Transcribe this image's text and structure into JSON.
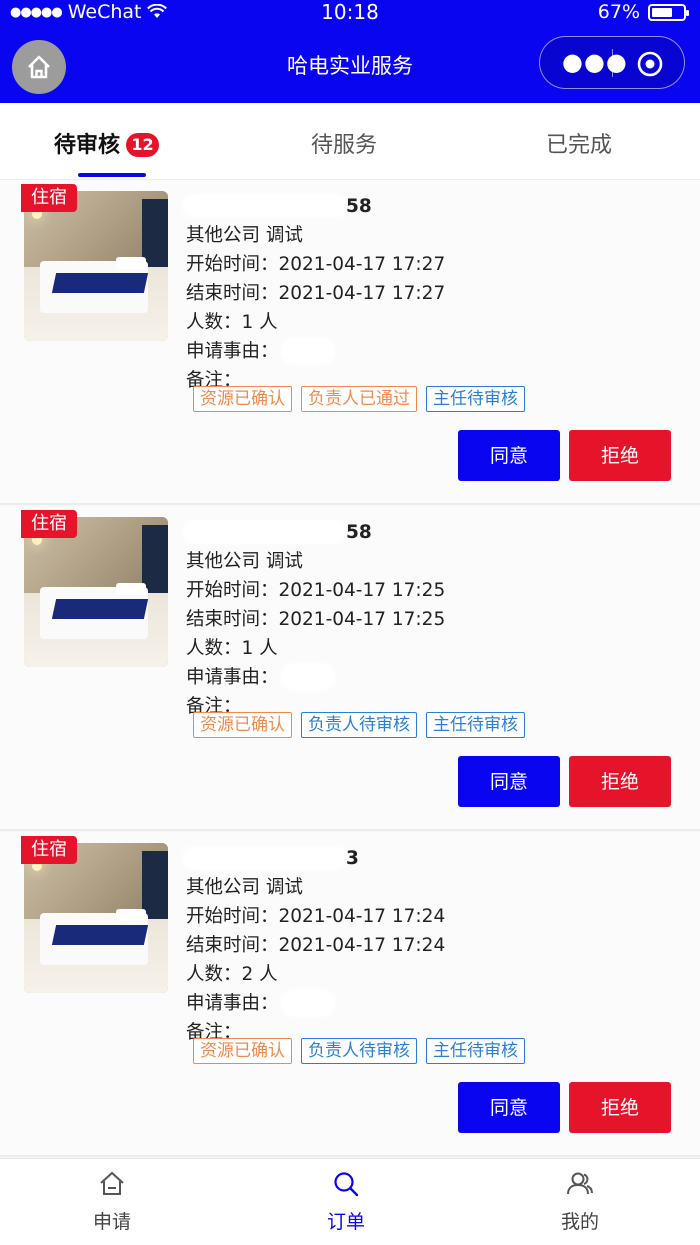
{
  "status_bar": {
    "signal": "●●●●●",
    "carrier": "WeChat",
    "time": "10:18",
    "battery": "67%",
    "battery_level": 0.67
  },
  "nav": {
    "title": "哈电实业服务"
  },
  "tabs": [
    {
      "label": "待审核",
      "badge": "12",
      "active": true
    },
    {
      "label": "待服务",
      "active": false
    },
    {
      "label": "已完成",
      "active": false
    }
  ],
  "orders": [
    {
      "tag": "住宿",
      "phone_suffix": "58",
      "company": "其他公司 调试",
      "start": "开始时间：2021-04-17 17:27",
      "end": "结束时间：2021-04-17 17:27",
      "people": "人数：1 人",
      "reason": "申请事由：",
      "remark": "备注：",
      "statuses": [
        {
          "text": "资源已确认",
          "color": "orange"
        },
        {
          "text": "负责人已通过",
          "color": "orange"
        },
        {
          "text": "主任待审核",
          "color": "blue"
        }
      ],
      "agree": "同意",
      "reject": "拒绝"
    },
    {
      "tag": "住宿",
      "phone_suffix": "58",
      "company": "其他公司 调试",
      "start": "开始时间：2021-04-17 17:25",
      "end": "结束时间：2021-04-17 17:25",
      "people": "人数：1 人",
      "reason": "申请事由：",
      "remark": "备注：",
      "statuses": [
        {
          "text": "资源已确认",
          "color": "orange"
        },
        {
          "text": "负责人待审核",
          "color": "blue"
        },
        {
          "text": "主任待审核",
          "color": "blue"
        }
      ],
      "agree": "同意",
      "reject": "拒绝"
    },
    {
      "tag": "住宿",
      "phone_suffix": "3",
      "company": "其他公司 调试",
      "start": "开始时间：2021-04-17 17:24",
      "end": "结束时间：2021-04-17 17:24",
      "people": "人数：2 人",
      "reason": "申请事由：",
      "remark": "备注：",
      "statuses": [
        {
          "text": "资源已确认",
          "color": "orange"
        },
        {
          "text": "负责人待审核",
          "color": "blue"
        },
        {
          "text": "主任待审核",
          "color": "blue"
        }
      ],
      "agree": "同意",
      "reject": "拒绝"
    }
  ],
  "bottom_nav": [
    {
      "label": "申请",
      "icon": "home-outline-icon",
      "active": false
    },
    {
      "label": "订单",
      "icon": "search-icon",
      "active": true
    },
    {
      "label": "我的",
      "icon": "users-icon",
      "active": false
    }
  ],
  "colors": {
    "primary": "#0a05f0",
    "danger": "#e6142a",
    "orange": "#ef8a4c",
    "blue": "#2a7fd4"
  }
}
